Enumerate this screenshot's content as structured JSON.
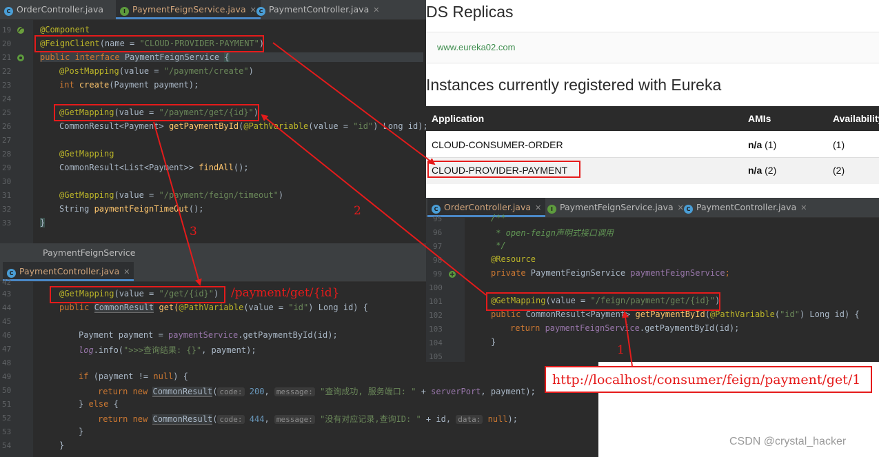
{
  "top_editor": {
    "tabs": [
      {
        "label": "OrderController.java",
        "icon": "class-icon"
      },
      {
        "label": "PaymentFeignService.java",
        "icon": "interface-icon"
      },
      {
        "label": "PaymentController.java",
        "icon": "class-icon"
      }
    ],
    "line_numbers": [
      "19",
      "20",
      "21",
      "22",
      "23",
      "24",
      "25",
      "26",
      "27",
      "28",
      "29",
      "30",
      "31",
      "32",
      "33"
    ],
    "lines": {
      "l19": "@Component",
      "l20_ann": "@FeignClient",
      "l20_a": "(name = ",
      "l20_s": "\"CLOUD-PROVIDER-PAYMENT\"",
      "l20_b": ")",
      "l21_kw": "public interface ",
      "l21_name": "PaymentFeignService ",
      "l21_brace": "{",
      "l22_ann": "@PostMapping",
      "l22_a": "(value = ",
      "l22_s": "\"/payment/create\"",
      "l22_b": ")",
      "l23_kw": "int ",
      "l23_fn": "create",
      "l23_b": "(Payment payment);",
      "l25_ann": "@GetMapping",
      "l25_a": "(value = ",
      "l25_s": "\"/payment/get/{id}\"",
      "l25_b": ")",
      "l26_a": "CommonResult<Payment> ",
      "l26_fn": "getPaymentById",
      "l26_b": "(",
      "l26_ann": "@PathVariable",
      "l26_c": "(value = ",
      "l26_s": "\"id\"",
      "l26_d": ") Long id);",
      "l28_ann": "@GetMapping",
      "l29_a": "CommonResult<List<Payment>> ",
      "l29_fn": "findAll",
      "l29_b": "();",
      "l31_ann": "@GetMapping",
      "l31_a": "(value = ",
      "l31_s": "\"/payment/feign/timeout\"",
      "l31_b": ")",
      "l32_a": "String ",
      "l32_fn": "paymentFeignTimeOut",
      "l32_b": "();",
      "l33": "}"
    },
    "breadcrumb": "PaymentFeignService"
  },
  "eureka": {
    "replicas_title": "DS Replicas",
    "replica_link": "www.eureka02.com",
    "instances_title": "Instances currently registered with Eureka",
    "columns": [
      "Application",
      "AMIs",
      "Availability"
    ],
    "rows": [
      {
        "app": "CLOUD-CONSUMER-ORDER",
        "amis_prefix": "n/a",
        "amis_count": "(1)",
        "availability": "(1)"
      },
      {
        "app": "CLOUD-PROVIDER-PAYMENT",
        "amis_prefix": "n/a",
        "amis_count": "(2)",
        "availability": "(2)"
      }
    ]
  },
  "bottom_left_editor": {
    "tab": {
      "label": "PaymentController.java",
      "icon": "class-icon"
    },
    "line_numbers": [
      "42",
      "43",
      "44",
      "45",
      "46",
      "47",
      "48",
      "49",
      "50",
      "51",
      "52",
      "53",
      "54"
    ],
    "lines": {
      "l43_ann": "@GetMapping",
      "l43_a": "(value = ",
      "l43_s": "\"/get/{id}\"",
      "l43_b": ")",
      "l44_kw": "public ",
      "l44_type": "CommonResult",
      "l44_a": " get(",
      "l44_ann": "@PathVariable",
      "l44_b": "(value = ",
      "l44_s": "\"id\"",
      "l44_c": ") Long id) {",
      "l46_a": "Payment payment = ",
      "l46_fld": "paymentService",
      "l46_b": ".getPaymentById(id);",
      "l47_log": "log",
      "l47_a": ".info(",
      "l47_s": "\">>>查询结果: {}\"",
      "l47_b": ", payment);",
      "l49_kw": "if ",
      "l49_a": "(payment != ",
      "l49_null": "null",
      "l49_b": ") {",
      "l50_kw": "return new ",
      "l50_type": "CommonResult",
      "l50_a": "(",
      "l50_hint1": "code:",
      "l50_num": " 200",
      "l50_b": ", ",
      "l50_hint2": "message:",
      "l50_s": " \"查询成功, 服务端口: \"",
      "l50_c": " + ",
      "l50_fld": "serverPort",
      "l50_d": ", payment);",
      "l51_a": "} ",
      "l51_kw": "else ",
      "l51_b": "{",
      "l52_kw": "return new ",
      "l52_type": "CommonResult",
      "l52_a": "(",
      "l52_hint1": "code:",
      "l52_num": " 444",
      "l52_b": ", ",
      "l52_hint2": "message:",
      "l52_s": " \"没有对应记录,查询ID: \"",
      "l52_c": " + id, ",
      "l52_hint3": "data:",
      "l52_null": " null",
      "l52_d": ");",
      "l53": "}",
      "l54": "}"
    }
  },
  "bottom_right_editor": {
    "tabs": [
      {
        "label": "OrderController.java",
        "icon": "class-icon"
      },
      {
        "label": "PaymentFeignService.java",
        "icon": "interface-icon"
      },
      {
        "label": "PaymentController.java",
        "icon": "class-icon"
      }
    ],
    "line_numbers": [
      "95",
      "96",
      "97",
      "98",
      "99",
      "100",
      "101",
      "102",
      "103",
      "104",
      "105"
    ],
    "lines": {
      "l95": "/**",
      "l96": " * open-feign声明式接口调用",
      "l97": " */",
      "l98": "@Resource",
      "l99_kw": "private ",
      "l99_a": "PaymentFeignService ",
      "l99_fld": "paymentFeignService",
      "l99_b": ";",
      "l101_ann": "@GetMapping",
      "l101_a": "(value = ",
      "l101_s": "\"/feign/payment/get/{id}\"",
      "l101_b": ")",
      "l102_kw": "public ",
      "l102_a": "CommonResult<Payment> ",
      "l102_fn": "getPaymentById",
      "l102_b": "(",
      "l102_ann": "@PathVariable",
      "l102_c": "(",
      "l102_s": "\"id\"",
      "l102_d": ") Long id) {",
      "l103_kw": "return ",
      "l103_fld": "paymentFeignService",
      "l103_a": ".getPaymentById(id);",
      "l104": "}"
    }
  },
  "annotations": {
    "path_label": "/payment/get/{id}",
    "url": "http://localhost/consumer/feign/payment/get/1",
    "step1": "1",
    "step2": "2",
    "step3": "3",
    "arrow_color": "#e51b1b"
  },
  "watermark": "CSDN @crystal_hacker"
}
